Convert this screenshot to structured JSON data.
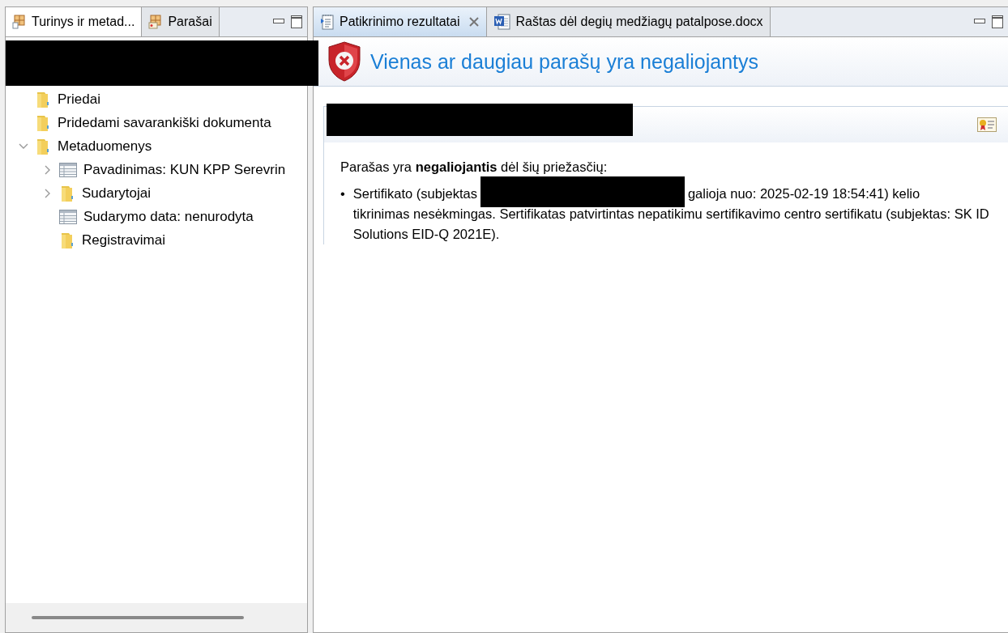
{
  "left_panel": {
    "tabs": [
      {
        "label": "Turinys ir metad...",
        "kind": "structure",
        "selected": true
      },
      {
        "label": "Parašai",
        "kind": "signature",
        "selected": false
      }
    ],
    "tree": [
      {
        "label": "Priedai",
        "kind": "folder"
      },
      {
        "label": "Pridedami savarankiški dokumenta",
        "kind": "folder"
      },
      {
        "label": "Metaduomenys",
        "kind": "folder",
        "expanded": true,
        "children": [
          {
            "label": "Pavadinimas: KUN KPP Serevrin",
            "kind": "table",
            "expanded": false
          },
          {
            "label": "Sudarytojai",
            "kind": "folder",
            "expanded": false
          },
          {
            "label": "Sudarymo data: nenurodyta",
            "kind": "table"
          },
          {
            "label": "Registravimai",
            "kind": "folder"
          }
        ]
      }
    ]
  },
  "right_panel": {
    "tabs": [
      {
        "label": "Patikrinimo rezultatai",
        "kind": "report",
        "selected": true,
        "closable": true
      },
      {
        "label": "Raštas dėl degių medžiagų patalpose.docx",
        "kind": "word",
        "selected": false,
        "closable": false
      }
    ],
    "title": "Vienas ar daugiau parašų yra negaliojantys",
    "summary": "Parašas yra **negaliojantis** dėl šių priežasčių:",
    "reasons": [
      {
        "marker": "•",
        "before": "Sertifikato (subjektas",
        "after": "galioja nuo: 2025-02-19 18:54:41) kelio",
        "continuation": "tikrinimas nesėkmingas. Sertifikatas patvirtintas nepatikimu sertifikavimo centro sertifikatu (subjektas: SK ID Solutions EID-Q 2021E)."
      }
    ]
  }
}
